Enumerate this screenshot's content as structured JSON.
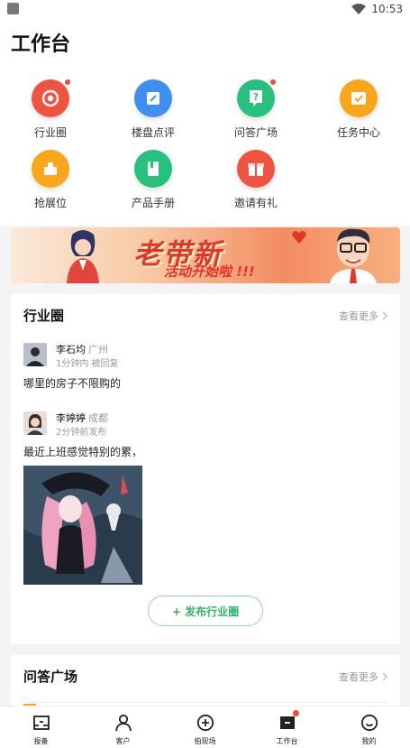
{
  "status_bar": {
    "time": "10:53"
  },
  "page": {
    "title": "工作台"
  },
  "features": [
    {
      "label": "行业圈",
      "icon": "industry-circle-icon",
      "color": "#f0533f",
      "badge": true
    },
    {
      "label": "楼盘点评",
      "icon": "building-review-icon",
      "color": "#3f8ff3",
      "badge": false
    },
    {
      "label": "问答广场",
      "icon": "qa-square-icon",
      "color": "#27c07d",
      "badge": true
    },
    {
      "label": "任务中心",
      "icon": "task-center-icon",
      "color": "#f9a61a",
      "badge": false
    },
    {
      "label": "抢展位",
      "icon": "booth-icon",
      "color": "#f9a61a",
      "badge": false
    },
    {
      "label": "产品手册",
      "icon": "product-manual-icon",
      "color": "#27c07d",
      "badge": false
    },
    {
      "label": "邀请有礼",
      "icon": "gift-icon",
      "color": "#f0533f",
      "badge": false
    }
  ],
  "banner": {
    "title": "老带新",
    "subtitle": "活动开始啦 !!!"
  },
  "industry_card": {
    "title": "行业圈",
    "see_more": "查看更多",
    "posts": [
      {
        "name": "李石均",
        "city": "广州",
        "meta": "1分钟内 被回复",
        "text": "哪里的房子不限购的"
      },
      {
        "name": "李婷婷",
        "city": "成都",
        "meta": "2分钟前发布",
        "text": "最近上班感觉特别的累，"
      }
    ],
    "publish_label": "+ 发布行业圈"
  },
  "qa_card": {
    "title": "问答广场",
    "see_more": "查看更多"
  },
  "tab_bar": {
    "tabs": [
      {
        "label": "报备",
        "icon": "report-icon"
      },
      {
        "label": "客户",
        "icon": "customer-icon"
      },
      {
        "label": "拍现场",
        "icon": "add-circle-icon"
      },
      {
        "label": "工作台",
        "icon": "workbench-icon",
        "badge": true
      },
      {
        "label": "我的",
        "icon": "smile-icon"
      }
    ]
  }
}
